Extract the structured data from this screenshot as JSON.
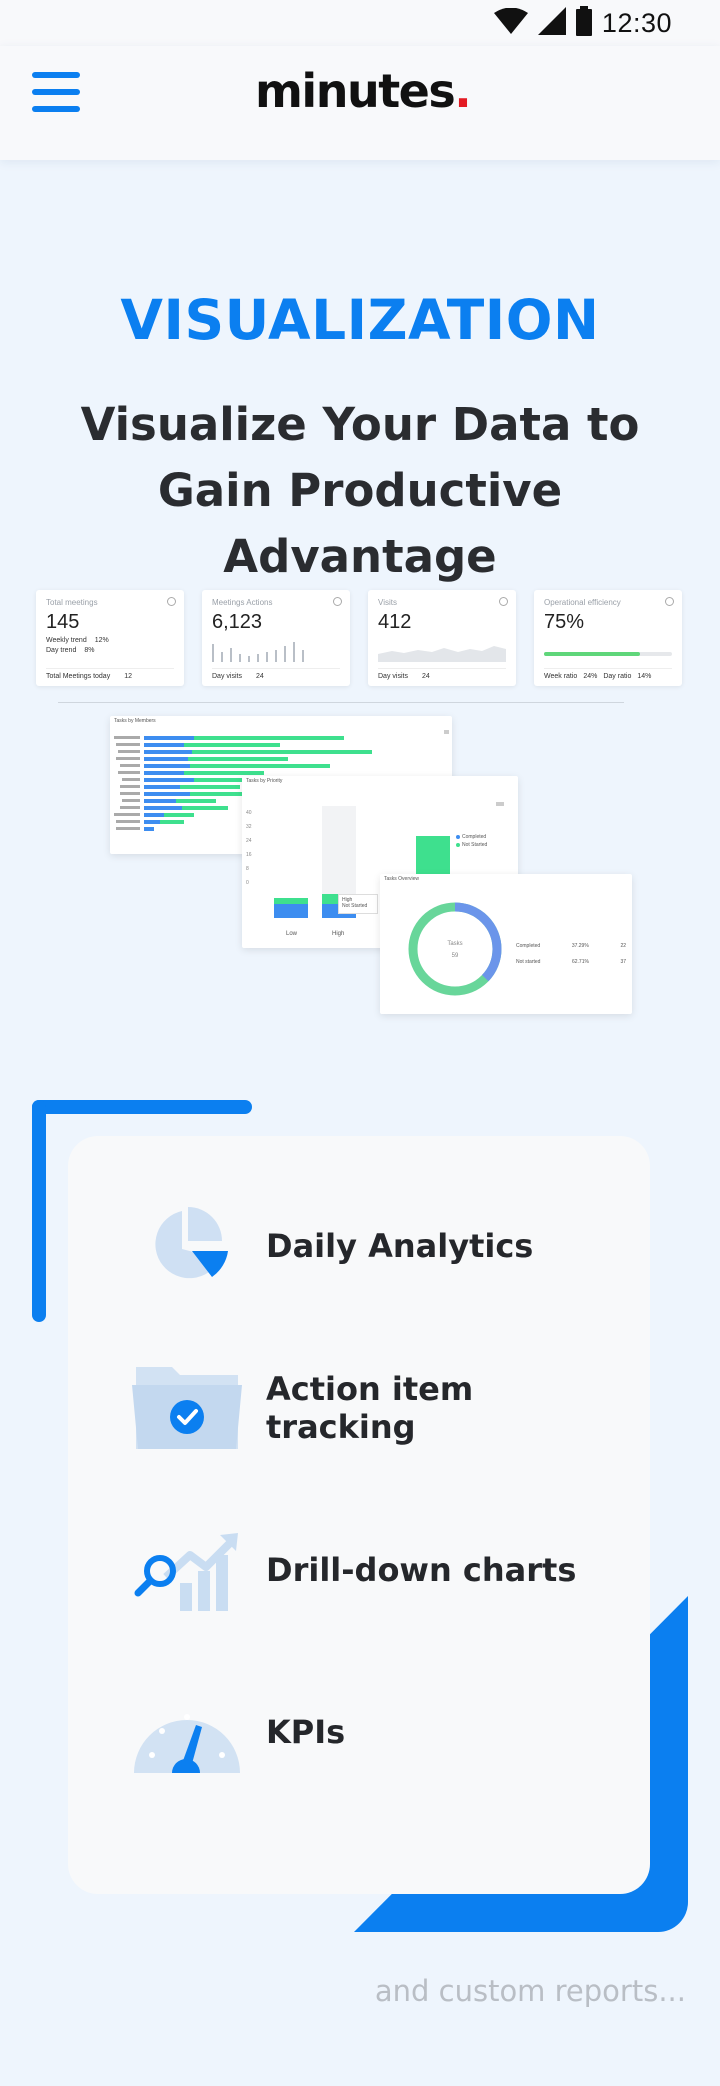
{
  "status_bar": {
    "time": "12:30",
    "icons": [
      "wifi-icon",
      "signal-icon",
      "battery-icon"
    ]
  },
  "header": {
    "logo_text": "minutes",
    "logo_dot": ".",
    "menu_icon": "hamburger-menu-icon",
    "brand_color": "#0b7ff0",
    "logo_dot_color": "#e31b23"
  },
  "hero": {
    "eyebrow": "VISUALIZATION",
    "title": "Visualize Your Data to Gain Productive Advantage"
  },
  "dashboard_preview": {
    "kpis": [
      {
        "label": "Total meetings",
        "value": "145",
        "rows": [
          [
            "Weekly trend",
            "12%"
          ],
          [
            "Day trend",
            "8%"
          ]
        ],
        "foot": [
          "Total Meetings today",
          "12"
        ]
      },
      {
        "label": "Meetings Actions",
        "value": "6,123",
        "foot": [
          "Day visits",
          "24"
        ]
      },
      {
        "label": "Visits",
        "value": "412",
        "foot": [
          "Day visits",
          "24"
        ]
      },
      {
        "label": "Operational efficiency",
        "value": "75%",
        "progress": 0.75,
        "foot": [
          "Week ratio",
          "24%",
          "Day ratio",
          "14%"
        ]
      }
    ],
    "panels": {
      "members_title": "Tasks by Members",
      "priority_title": "Tasks by Priority",
      "priority_legend": [
        "Completed",
        "Not Started"
      ],
      "priority_x": [
        "Low",
        "High"
      ],
      "priority_y": [
        "40",
        "32",
        "24",
        "16",
        "8",
        "0"
      ],
      "tooltip": "High",
      "tooltip_row": "Not Started",
      "overview_title": "Tasks Overview",
      "overview_center": "Tasks",
      "overview_center_value": "59",
      "overview_legend": [
        [
          "Completed",
          "37.29%",
          "22"
        ],
        [
          "Not started",
          "62.71%",
          "37"
        ]
      ]
    },
    "colors": {
      "blue": "#3d8df0",
      "green": "#3ee08e",
      "donut_blue": "#6b95ea",
      "donut_green": "#68d69a"
    }
  },
  "features": [
    {
      "label": "Daily Analytics",
      "icon": "pie-chart-icon"
    },
    {
      "label": "Action item tracking",
      "icon": "folder-check-icon"
    },
    {
      "label": "Drill-down charts",
      "icon": "search-growth-chart-icon"
    },
    {
      "label": "KPIs",
      "icon": "gauge-icon"
    }
  ],
  "footer_note": "and custom reports..."
}
